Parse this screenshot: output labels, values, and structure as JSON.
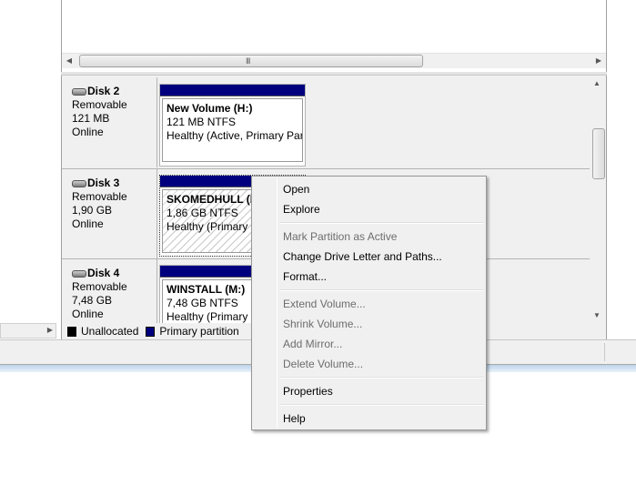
{
  "disks": [
    {
      "name": "Disk 2",
      "type": "Removable",
      "size": "121 MB",
      "status": "Online",
      "partition": {
        "title": "New Volume  (H:)",
        "detail": "121 MB NTFS",
        "health": "Healthy (Active, Primary Par"
      }
    },
    {
      "name": "Disk 3",
      "type": "Removable",
      "size": "1,90 GB",
      "status": "Online",
      "partition": {
        "title": "SKOMEDHULL  (K",
        "detail": "1,86 GB NTFS",
        "health": "Healthy (Primary P"
      }
    },
    {
      "name": "Disk 4",
      "type": "Removable",
      "size": "7,48 GB",
      "status": "Online",
      "partition": {
        "title": "WINSTALL  (M:)",
        "detail": "7,48 GB NTFS",
        "health": "Healthy (Primary P"
      }
    }
  ],
  "scrollbar": {
    "left_arrow": "◀",
    "right_arrow": "▶",
    "up_arrow": "▲",
    "down_arrow": "▼",
    "grip": "III"
  },
  "legend": {
    "items": [
      {
        "label": "Unallocated",
        "color": "#000000"
      },
      {
        "label": "Primary partition",
        "color": "#00007f"
      }
    ]
  },
  "context_menu": {
    "open": "Open",
    "explore": "Explore",
    "mark_active": "Mark Partition as Active",
    "change_letter": "Change Drive Letter and Paths...",
    "format": "Format...",
    "extend": "Extend Volume...",
    "shrink": "Shrink Volume...",
    "add_mirror": "Add Mirror...",
    "delete": "Delete Volume...",
    "properties": "Properties",
    "help": "Help"
  },
  "colors": {
    "primary_partition": "#00007f",
    "menu_bg": "#f0f0f0",
    "disabled_text": "#6d6d6d"
  }
}
